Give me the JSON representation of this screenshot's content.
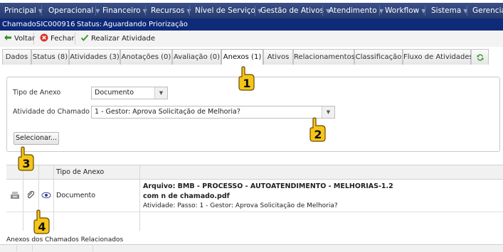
{
  "menu": {
    "items": [
      "Principal",
      "Operacional",
      "Financeiro",
      "Recursos",
      "Nível de Serviço",
      "Gestão de Ativos",
      "Atendimento",
      "Workflow",
      "Sistema",
      "Gerencial"
    ]
  },
  "info": {
    "chamado_label": "Chamado:",
    "chamado_value": "SIC000916",
    "status_label": "Status:",
    "status_value": "Aguardando Priorização"
  },
  "toolbar": {
    "voltar": "Voltar",
    "fechar": "Fechar",
    "realizar": "Realizar Atividade"
  },
  "tabs": [
    "Dados",
    "Status (8)",
    "Atividades (3)",
    "Anotações (0)",
    "Avaliação (0)",
    "Anexos (1)",
    "Ativos",
    "Relacionamentos",
    "Classificação",
    "Fluxo de Atividades"
  ],
  "form": {
    "tipo_label": "Tipo de Anexo",
    "tipo_value": "Documento",
    "atividade_label": "Atividade do Chamado",
    "atividade_value": "1 - Gestor: Aprova Solicitação de Melhoria?",
    "selecionar": "Selecionar..."
  },
  "grid": {
    "header_tipo": "Tipo de Anexo",
    "row": {
      "tipo": "Documento",
      "arquivo_line1": "Arquivo: BMB - PROCESSO - AUTOATENDIMENTO - MELHORIAS-1.2",
      "arquivo_line2": "com n de chamado.pdf",
      "atividade": "Atividade: Passo: 1 - Gestor: Aprova Solicitação de Melhoria?"
    }
  },
  "related": {
    "title": "Anexos dos Chamados Relacionados"
  },
  "callouts": [
    "1",
    "2",
    "3",
    "4"
  ],
  "colors": {
    "menubar": "#2f4479",
    "infobar": "#0f2a78",
    "callout": "#f5c518"
  }
}
